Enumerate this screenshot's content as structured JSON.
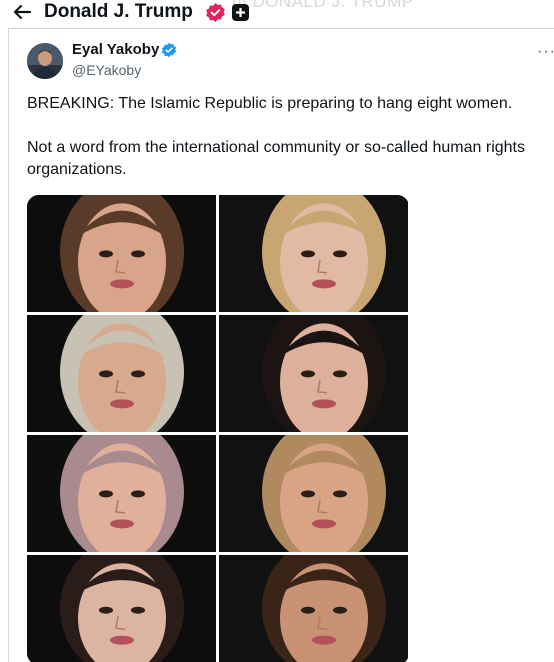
{
  "header": {
    "title": "Donald J. Trump",
    "ghost_text": "nt DONALD J. TRUMP",
    "badge_color": "#e0245e"
  },
  "tweet": {
    "author_name": "Eyal Yakoby",
    "author_handle": "@EYakoby",
    "verified_color": "#1d9bf0",
    "more_label": "···",
    "text_line1": "BREAKING: The Islamic Republic is preparing to hang eight women.",
    "text_line2": "Not a word from the international community or so-called human rights organizations."
  },
  "photos": [
    {
      "name": "portrait-1",
      "hair": "#5a3b2a",
      "skin": "#d9a58a",
      "bg": "#0d0d0d"
    },
    {
      "name": "portrait-2",
      "hair": "#c9a572",
      "skin": "#e2b9a3",
      "bg": "#111111"
    },
    {
      "name": "portrait-3",
      "hair": "#c8c2b4",
      "skin": "#d7a98f",
      "bg": "#0d0d0d"
    },
    {
      "name": "portrait-4",
      "hair": "#1c1412",
      "skin": "#dcb09a",
      "bg": "#111111"
    },
    {
      "name": "portrait-5",
      "hair": "#a88a8f",
      "skin": "#e0b09b",
      "bg": "#0e0e0e"
    },
    {
      "name": "portrait-6",
      "hair": "#b08a5e",
      "skin": "#d9a486",
      "bg": "#111111"
    },
    {
      "name": "portrait-7",
      "hair": "#2a1c18",
      "skin": "#dcb4a2",
      "bg": "#0d0d0d"
    },
    {
      "name": "portrait-8",
      "hair": "#3a2418",
      "skin": "#c99274",
      "bg": "#111111"
    }
  ]
}
